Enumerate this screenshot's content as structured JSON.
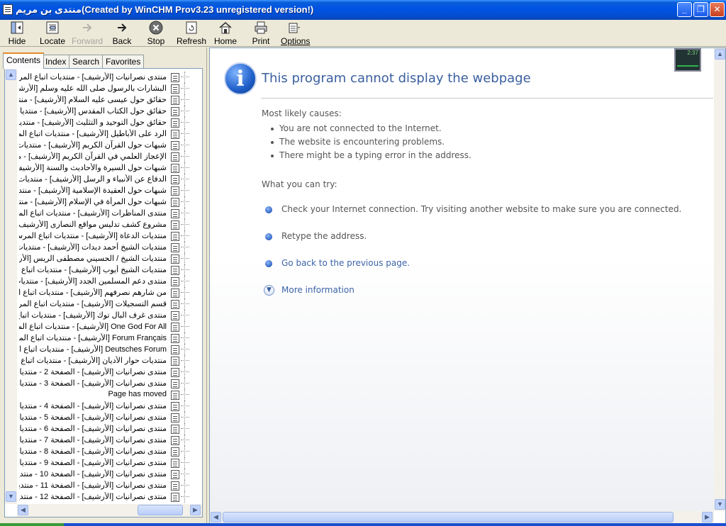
{
  "window": {
    "title": "منتدى بن مريم(Created by WinCHM Prov3.23 unregistered version!)",
    "controls": {
      "minimize": "_",
      "maximize": "❐",
      "close": "✕"
    }
  },
  "toolbar": {
    "buttons": [
      {
        "label": "Hide",
        "icon": "hide-icon",
        "enabled": true
      },
      {
        "label": "Locate",
        "icon": "locate-icon",
        "enabled": true
      },
      {
        "label": "Forward",
        "icon": "forward-arrow-icon",
        "enabled": false
      },
      {
        "label": "Back",
        "icon": "back-arrow-icon",
        "enabled": true
      },
      {
        "label": "Stop",
        "icon": "stop-icon",
        "enabled": true
      },
      {
        "label": "Refresh",
        "icon": "refresh-icon",
        "enabled": true
      },
      {
        "label": "Home",
        "icon": "home-icon",
        "enabled": true
      },
      {
        "label": "Print",
        "icon": "printer-icon",
        "enabled": true
      },
      {
        "label": "Options",
        "icon": "options-icon",
        "enabled": true
      }
    ]
  },
  "tabs": [
    {
      "label": "Contents",
      "active": true
    },
    {
      "label": "Index",
      "active": false
    },
    {
      "label": "Search",
      "active": false
    },
    {
      "label": "Favorites",
      "active": false
    }
  ],
  "tree": {
    "items": [
      "منتدى نصرانيات [الأرشيف] - منتديات اتباع المرسلين الإسلامية",
      "البشارات بالرسول صلى الله عليه وسلم [الأرشيف] - منتديات اتباع المرسلين",
      "حقائق حول عيسى عليه السلام [الأرشيف] - منتديات اتباع المرسلين",
      "حقائق حول الكتاب المقدس [الأرشيف] - منتديات اتباع المرسلين",
      "حقائق حول التوحيد و التثليث [الأرشيف] - منتديات اتباع المرسلين",
      "الرد على الأباطيل [الأرشيف] - منتديات اتباع المرسلين الإسلامية",
      "شبهات حول القرآن الكريم [الأرشيف] - منتديات اتباع المرسلين",
      "الإعجاز العلمي في القرآن الكريم [الأرشيف] - منتديات اتباع المرسلين",
      "شبهات حول السيرة والأحاديث والسنة [الأرشيف] - منتديات اتباع المرسلين",
      "الدفاع عن الأنبياء و الرسل [الأرشيف] - منتديات اتباع المرسلين",
      "شبهات حول العقيدة الإسلامية [الأرشيف] - منتديات اتباع المرسلين",
      "شبهات حول المرأة في الإسلام [الأرشيف] - منتديات اتباع المرسلين",
      "منتدى المناظرات [الأرشيف] - منتديات اتباع المرسلين الإسلامية",
      "مشروع كشف تدليس مواقع النصارى [الأرشيف] - منتديات اتباع المرسلين",
      "منتديات الدعاة [الأرشيف] - منتديات اتباع المرسلين الإسلامية",
      "منتديات الشيخ أحمد ديدات [الأرشيف] - منتديات اتباع المرسلين",
      "منتديات الشيخ / الحسيني مصطفى الريس [الأرشيف] - منتديات اتباع المرسلين",
      "منتديات الشيخ أيوب [الأرشيف] - منتديات اتباع المرسلين الإسلامية",
      "منتدى دعم المسلمين الجدد [الأرشيف] - منتديات اتباع المرسلين",
      "من شارهم نصرفهم [الأرشيف] - منتديات اتباع المرسلين الإسلامية",
      "قسم التسجيلات [الأرشيف] - منتديات اتباع المرسلين الإسلامية",
      "منتدى غرف البال توك [الأرشيف] - منتديات اتباع المرسلين",
      "One God For All [الأرشيف] - منتديات اتباع المرسلين",
      "Forum Français [الأرشيف] - منتديات اتباع المرسلين",
      "Deutsches Forum [الأرشيف] - منتديات اتباع المرسلين",
      "منتديات حوار الأديان [الأرشيف] - منتديات اتباع المرسلين",
      "منتدى نصرانيات [الأرشيف] - الصفحة 2 - منتديات اتباع المرسلين",
      "منتدى نصرانيات [الأرشيف] - الصفحة 3 - منتديات اتباع المرسلين",
      "Page has moved",
      "منتدى نصرانيات [الأرشيف] - الصفحة 4 - منتديات اتباع المرسلين",
      "منتدى نصرانيات [الأرشيف] - الصفحة 5 - منتديات اتباع المرسلين",
      "منتدى نصرانيات [الأرشيف] - الصفحة 6 - منتديات اتباع المرسلين",
      "منتدى نصرانيات [الأرشيف] - الصفحة 7 - منتديات اتباع المرسلين",
      "منتدى نصرانيات [الأرشيف] - الصفحة 8 - منتديات اتباع المرسلين",
      "منتدى نصرانيات [الأرشيف] - الصفحة 9 - منتديات اتباع المرسلين",
      "منتدى نصرانيات [الأرشيف] - الصفحة 10 - منتديات اتباع المرسلين",
      "منتدى نصرانيات [الأرشيف] - الصفحة 11 - منتديات اتباع المرسلين",
      "منتدى نصرانيات [الأرشيف] - الصفحة 12 - منتديات اتباع المرسلين"
    ]
  },
  "error_page": {
    "title": "This program cannot display the webpage",
    "causes_heading": "Most likely causes:",
    "causes": [
      "You are not connected to the Internet.",
      "The website is encountering problems.",
      "There might be a typing error in the address."
    ],
    "try_heading": "What you can try:",
    "try_items": [
      "Check your Internet connection. Try visiting another website to make sure you are connected.",
      "Retype the address.",
      "Go back to the previous page."
    ],
    "more_info": "More information",
    "mini_graph_value": "2:37"
  },
  "colors": {
    "titlebar": "#0054e3",
    "link": "#3c64a8",
    "heading": "#3a5f9f",
    "tab_highlight": "#e68b2c"
  }
}
